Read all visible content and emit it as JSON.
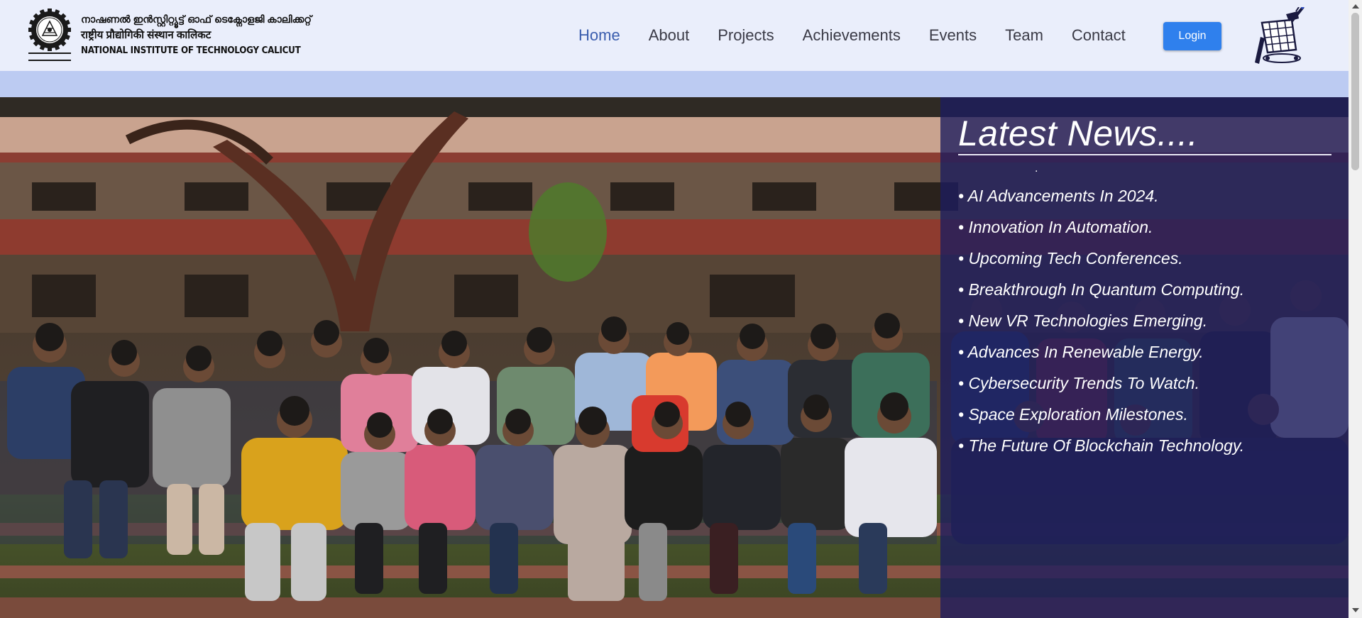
{
  "header": {
    "institute_name_malayalam": "നാഷണൽ ഇൻസ്റ്റിറ്റ്യൂട്ട് ഓഫ് ടെക്നോളജി കാലിക്കറ്റ്",
    "institute_name_hindi": "राष्ट्रीय प्रौद्योगिकी संस्थान कालिकट",
    "institute_name_english": "NATIONAL INSTITUTE OF TECHNOLOGY CALICUT",
    "emblem_icon": "nitc-emblem-icon",
    "club_logo_icon": "robot-club-logo-icon"
  },
  "nav": {
    "items": [
      {
        "label": "Home",
        "active": true
      },
      {
        "label": "About"
      },
      {
        "label": "Projects"
      },
      {
        "label": "Achievements"
      },
      {
        "label": "Events"
      },
      {
        "label": "Team"
      },
      {
        "label": "Contact"
      }
    ],
    "login_label": "Login"
  },
  "news": {
    "title": "Latest News....",
    "items": [
      "• AI Advancements In 2024.",
      "• Innovation In Automation.",
      "• Upcoming Tech Conferences.",
      "• Breakthrough In Quantum Computing.",
      "• New VR Technologies Emerging.",
      "• Advances In Renewable Energy.",
      "• Cybersecurity Trends To Watch.",
      "• Space Exploration Milestones.",
      "• The Future Of Blockchain Technology."
    ]
  },
  "colors": {
    "header_bg": "#eaeefb",
    "subbar_bg": "#bccbf2",
    "nav_active": "#3a5dae",
    "login_bg": "#2f80ed",
    "news_panel_bg": "rgba(28,28,95,0.78)"
  }
}
